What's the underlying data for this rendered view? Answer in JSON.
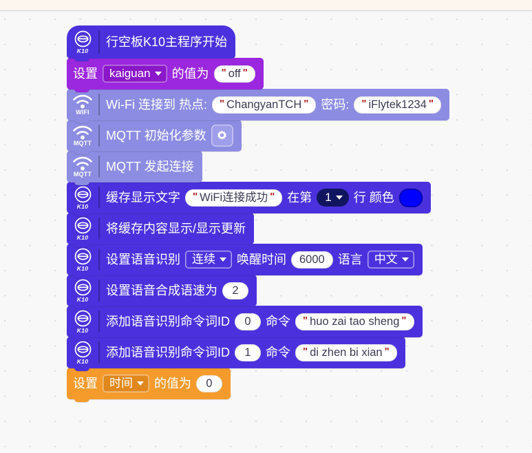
{
  "app": {
    "canvas_name": "block-programming-canvas",
    "colors": {
      "k10_block": "#4B31DD",
      "variable_block": "#9B27DE",
      "network_block": "#8C8CE2",
      "orange_block": "#F59B2B",
      "color_swatch": "#0000FF",
      "canvas_background": "#f8f8f9"
    }
  },
  "blocks": [
    {
      "id": "hat-k10-start",
      "icon": "k10-icon",
      "icon_label": "K10",
      "kind": "hat",
      "color": "k10",
      "parts": [
        {
          "type": "label",
          "text": "行空板K10主程序开始"
        }
      ]
    },
    {
      "id": "set-variable-kaiguan",
      "icon": null,
      "kind": "stack",
      "color": "variable",
      "parts": [
        {
          "type": "label",
          "text": "设置"
        },
        {
          "type": "dropdown",
          "value": "kaiguan"
        },
        {
          "type": "label",
          "text": "的值为"
        },
        {
          "type": "text",
          "value": "off"
        }
      ]
    },
    {
      "id": "wifi-connect",
      "icon": "wifi-icon",
      "icon_label": "WIFI",
      "kind": "stack",
      "color": "network",
      "parts": [
        {
          "type": "label",
          "text": "Wi-Fi 连接到 热点:"
        },
        {
          "type": "text",
          "value": "ChangyanTCH"
        },
        {
          "type": "label",
          "text": "密码:"
        },
        {
          "type": "text",
          "value": "iFlytek1234"
        }
      ]
    },
    {
      "id": "mqtt-init",
      "icon": "wifi-icon",
      "icon_label": "MQTT",
      "kind": "stack",
      "color": "network",
      "parts": [
        {
          "type": "label",
          "text": "MQTT 初始化参数"
        },
        {
          "type": "gear",
          "name": "gear-icon"
        }
      ]
    },
    {
      "id": "mqtt-connect",
      "icon": "wifi-icon",
      "icon_label": "MQTT",
      "kind": "stack",
      "color": "network",
      "parts": [
        {
          "type": "label",
          "text": "MQTT 发起连接"
        }
      ]
    },
    {
      "id": "buffer-display-text",
      "icon": "k10-icon",
      "icon_label": "K10",
      "kind": "stack",
      "color": "k10",
      "parts": [
        {
          "type": "label",
          "text": "缓存显示文字"
        },
        {
          "type": "text",
          "value": "WiFi连接成功"
        },
        {
          "type": "label",
          "text": "在第"
        },
        {
          "type": "dropdown-dark",
          "value": "1"
        },
        {
          "type": "label",
          "text": "行 颜色"
        },
        {
          "type": "color",
          "value": "#0000FF"
        }
      ]
    },
    {
      "id": "buffer-refresh",
      "icon": "k10-icon",
      "icon_label": "K10",
      "kind": "stack",
      "color": "k10",
      "parts": [
        {
          "type": "label",
          "text": "将缓存内容显示/显示更新"
        }
      ]
    },
    {
      "id": "set-speech-recognition",
      "icon": "k10-icon",
      "icon_label": "K10",
      "kind": "stack",
      "color": "k10",
      "parts": [
        {
          "type": "label",
          "text": "设置语音识别"
        },
        {
          "type": "dropdown-outline",
          "value": "连续"
        },
        {
          "type": "label",
          "text": "唤醒时间"
        },
        {
          "type": "number",
          "value": "6000"
        },
        {
          "type": "label",
          "text": "语言"
        },
        {
          "type": "dropdown-outline",
          "value": "中文"
        }
      ]
    },
    {
      "id": "set-tts-speed",
      "icon": "k10-icon",
      "icon_label": "K10",
      "kind": "stack",
      "color": "k10",
      "parts": [
        {
          "type": "label",
          "text": "设置语音合成语速为"
        },
        {
          "type": "number",
          "value": "2"
        }
      ]
    },
    {
      "id": "add-command-word-0",
      "icon": "k10-icon",
      "icon_label": "K10",
      "kind": "stack",
      "color": "k10",
      "parts": [
        {
          "type": "label",
          "text": "添加语音识别命令词ID"
        },
        {
          "type": "number",
          "value": "0"
        },
        {
          "type": "label",
          "text": "命令"
        },
        {
          "type": "text",
          "value": "huo zai tao sheng"
        }
      ]
    },
    {
      "id": "add-command-word-1",
      "icon": "k10-icon",
      "icon_label": "K10",
      "kind": "stack",
      "color": "k10",
      "parts": [
        {
          "type": "label",
          "text": "添加语音识别命令词ID"
        },
        {
          "type": "number",
          "value": "1"
        },
        {
          "type": "label",
          "text": "命令"
        },
        {
          "type": "text",
          "value": "di zhen bi xian"
        }
      ]
    },
    {
      "id": "set-variable-time",
      "icon": null,
      "kind": "stack",
      "color": "orange",
      "parts": [
        {
          "type": "label",
          "text": "设置"
        },
        {
          "type": "dropdown",
          "value": "时间"
        },
        {
          "type": "label",
          "text": "的值为"
        },
        {
          "type": "number",
          "value": "0"
        }
      ]
    }
  ]
}
